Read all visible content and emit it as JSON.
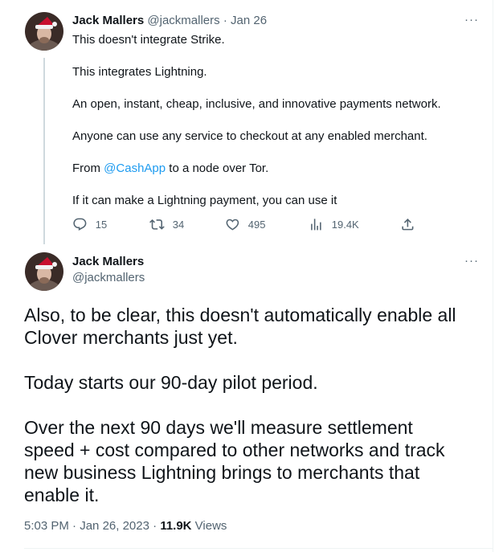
{
  "tweet1": {
    "author_name": "Jack Mallers",
    "author_handle": "@jackmallers",
    "separator": "·",
    "date": "Jan 26",
    "more_label": "···",
    "lines": [
      "This doesn't integrate Strike.",
      "This integrates Lightning.",
      "An open, instant, cheap, inclusive, and innovative payments network.",
      "Anyone can use any service to checkout at any enabled merchant."
    ],
    "from_prefix": "From ",
    "from_mention": "@CashApp",
    "from_suffix": " to a node over Tor.",
    "last_line": "If it can make a Lightning payment, you can use it",
    "stats": {
      "replies": "15",
      "retweets": "34",
      "likes": "495",
      "views": "19.4K"
    }
  },
  "tweet2": {
    "author_name": "Jack Mallers",
    "author_handle": "@jackmallers",
    "more_label": "···",
    "body_lines": [
      "Also, to be clear, this doesn't automatically enable all",
      "Clover merchants just yet.",
      "Today starts our 90-day pilot period.",
      "Over the next 90 days we'll measure settlement",
      "speed + cost compared to other networks and track",
      "new business Lightning brings to merchants that",
      "enable it."
    ],
    "time": "5:03 PM",
    "separator1": " · ",
    "date": "Jan 26, 2023",
    "separator2": " · ",
    "views_count": "11.9K",
    "views_label": " Views"
  },
  "colors": {
    "accent": "#1d9bf0",
    "secondary_text": "#536471",
    "primary_text": "#0f1419",
    "thread_line": "#cfd9de"
  },
  "icons": {
    "reply": "reply-icon",
    "retweet": "retweet-icon",
    "like": "heart-icon",
    "views": "analytics-icon",
    "share": "share-icon"
  }
}
